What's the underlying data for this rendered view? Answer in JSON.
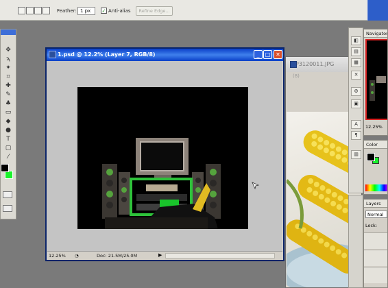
{
  "options_bar": {
    "feather_label": "Feather:",
    "feather_value": "1 px",
    "anti_alias_label": "Anti-alias",
    "anti_alias_checked": "✓",
    "refine_edge_label": "Refine Edge..."
  },
  "toolbox": {
    "tools": [
      {
        "icon": "move-icon",
        "glyph": "✥"
      },
      {
        "icon": "lasso-icon",
        "glyph": "ϡ"
      },
      {
        "icon": "magic-wand-icon",
        "glyph": "✦"
      },
      {
        "icon": "crop-icon",
        "glyph": "⌗"
      },
      {
        "icon": "heal-icon",
        "glyph": "✚"
      },
      {
        "icon": "brush-icon",
        "glyph": "✎"
      },
      {
        "icon": "stamp-icon",
        "glyph": "♣"
      },
      {
        "icon": "eraser-icon",
        "glyph": "▭"
      },
      {
        "icon": "bucket-icon",
        "glyph": "◆"
      },
      {
        "icon": "dodge-icon",
        "glyph": "●"
      },
      {
        "icon": "type-icon",
        "glyph": "T"
      },
      {
        "icon": "shape-icon",
        "glyph": "▢"
      },
      {
        "icon": "eyedropper-icon",
        "glyph": "⁄"
      },
      {
        "icon": "zoom-icon",
        "glyph": "⌕"
      }
    ],
    "foreground_color": "#000000",
    "background_color": "#19f22c"
  },
  "front_document": {
    "title": "1.psd @ 12.2% (Layer 7, RGB/8)",
    "status_zoom": "12.25%",
    "status_doc": "Doc: 21.5M/25.0M",
    "status_arrow": "▶"
  },
  "back_document": {
    "title": "P3120011.JPG",
    "subtitle": "(8)"
  },
  "right_strip": {
    "buttons": [
      {
        "icon": "palette-icon-1",
        "glyph": "◧"
      },
      {
        "icon": "palette-icon-2",
        "glyph": "▤"
      },
      {
        "icon": "palette-icon-3",
        "glyph": "▦"
      },
      {
        "icon": "tools-icon",
        "glyph": "✕"
      },
      {
        "icon": "clone-icon",
        "glyph": "⚙"
      },
      {
        "icon": "action-icon",
        "glyph": "▣"
      },
      {
        "icon": "character-icon",
        "glyph": "A"
      },
      {
        "icon": "paragraph-icon",
        "glyph": "¶"
      },
      {
        "icon": "layer-comps-icon",
        "glyph": "▥"
      }
    ]
  },
  "navigator": {
    "tab_label": "Navigator",
    "zoom": "12.25%"
  },
  "color_palette": {
    "tab_label": "Color",
    "foreground": "#000000",
    "background": "#19f22c"
  },
  "layers_palette": {
    "tab_label": "Layers",
    "blend_mode": "Normal",
    "lock_label": "Lock:"
  }
}
